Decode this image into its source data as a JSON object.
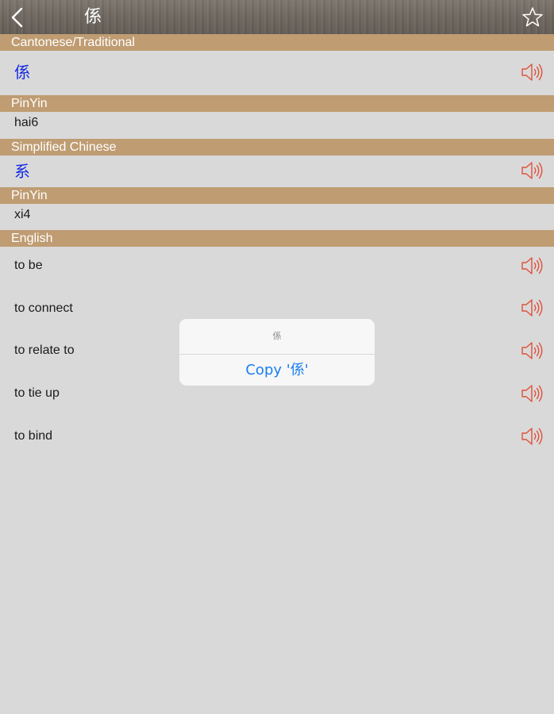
{
  "navbar": {
    "title": "係"
  },
  "sections": {
    "cantonese": {
      "header": "Cantonese/Traditional",
      "char": "係"
    },
    "pinyin1": {
      "header": "PinYin",
      "value": "hai6"
    },
    "simplified": {
      "header": "Simplified Chinese",
      "char": "系"
    },
    "pinyin2": {
      "header": "PinYin",
      "value": "xi4"
    },
    "english": {
      "header": "English",
      "items": [
        {
          "label": "to be"
        },
        {
          "label": "to connect"
        },
        {
          "label": "to relate to"
        },
        {
          "label": "to tie up"
        },
        {
          "label": "to bind"
        }
      ]
    }
  },
  "popup": {
    "title": "係",
    "copy_label": "Copy '係'"
  },
  "colors": {
    "section_header": "#bf9c72",
    "hanzi": "#1429e6",
    "speaker": "#e0503a",
    "popup_button": "#1a7ef0"
  },
  "icons": {
    "back": "back-chevron-icon",
    "favorite": "star-icon",
    "audio": "speaker-icon"
  }
}
